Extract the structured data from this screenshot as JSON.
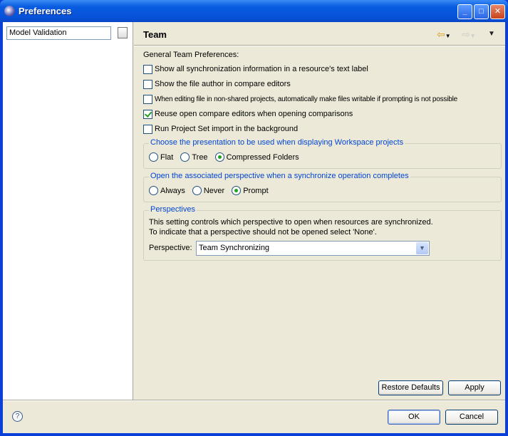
{
  "window": {
    "title": "Preferences"
  },
  "filter": {
    "value": "Model Validation"
  },
  "page": {
    "title": "Team"
  },
  "general": {
    "label": "General Team Preferences:",
    "options": [
      {
        "label": "Show all synchronization information in a resource's text label",
        "checked": false
      },
      {
        "label": "Show the file author in compare editors",
        "checked": false
      },
      {
        "label": "When editing file in non-shared projects, automatically make files writable if prompting is not possible",
        "checked": false
      },
      {
        "label": "Reuse open compare editors when opening comparisons",
        "checked": true
      },
      {
        "label": "Run Project Set import in the background",
        "checked": false
      }
    ]
  },
  "presentation": {
    "legend": "Choose the presentation to be used when displaying Workspace projects",
    "options": [
      {
        "label": "Flat",
        "selected": false
      },
      {
        "label": "Tree",
        "selected": false
      },
      {
        "label": "Compressed Folders",
        "selected": true
      }
    ]
  },
  "perspective_open": {
    "legend": "Open the associated perspective when a synchronize operation completes",
    "options": [
      {
        "label": "Always",
        "selected": false
      },
      {
        "label": "Never",
        "selected": false
      },
      {
        "label": "Prompt",
        "selected": true
      }
    ]
  },
  "perspectives": {
    "legend": "Perspectives",
    "desc1": "This setting controls which perspective to open when resources are synchronized.",
    "desc2": "To indicate that a perspective should not be opened select 'None'.",
    "label": "Perspective:",
    "value": "Team Synchronizing"
  },
  "buttons": {
    "restore": "Restore Defaults",
    "apply": "Apply",
    "ok": "OK",
    "cancel": "Cancel"
  },
  "icons": {
    "help": "?"
  }
}
